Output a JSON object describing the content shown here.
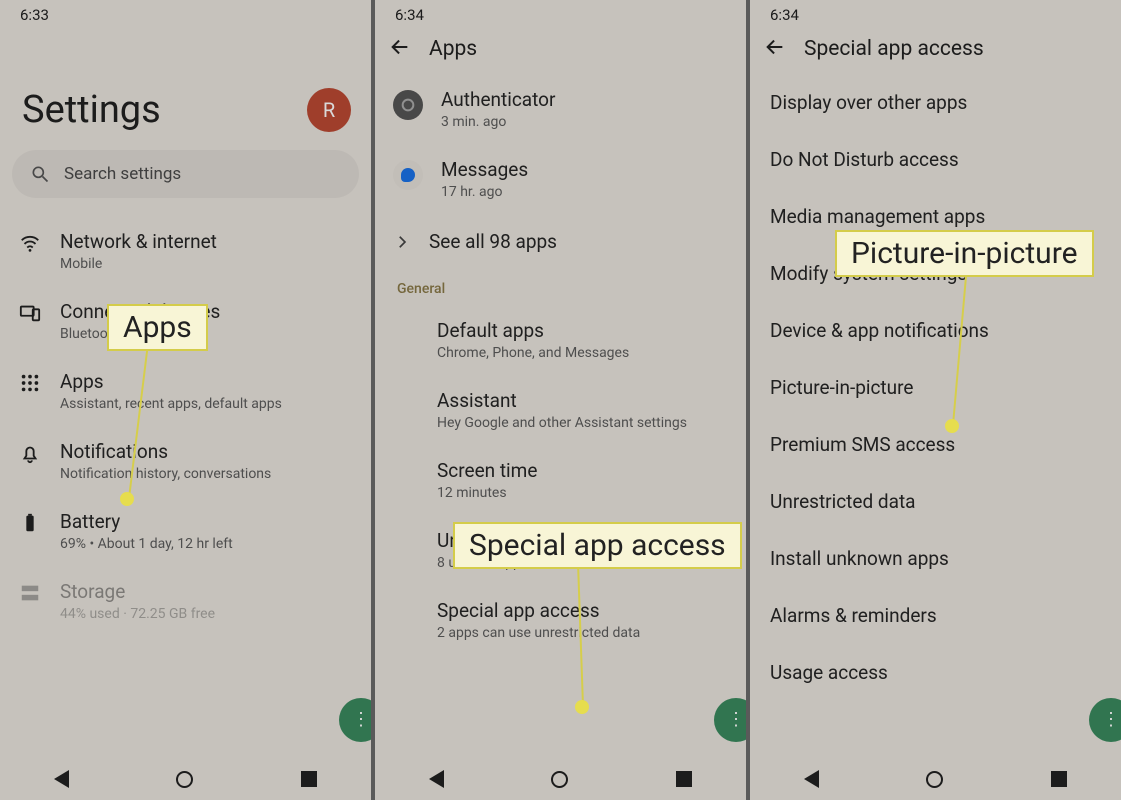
{
  "panel1": {
    "time": "6:33",
    "title": "Settings",
    "avatar": "R",
    "searchPlaceholder": "Search settings",
    "items": [
      {
        "title": "Network & internet",
        "sub": "Mobile"
      },
      {
        "title": "Connected devices",
        "sub": "Bluetooth, pairing"
      },
      {
        "title": "Apps",
        "sub": "Assistant, recent apps, default apps"
      },
      {
        "title": "Notifications",
        "sub": "Notification history, conversations"
      },
      {
        "title": "Battery",
        "sub": "69% • About 1 day, 12 hr left"
      },
      {
        "title": "Storage",
        "sub": "44% used · 72.25 GB free"
      }
    ],
    "callout": "Apps"
  },
  "panel2": {
    "time": "6:34",
    "header": "Apps",
    "recentApps": [
      {
        "title": "Authenticator",
        "sub": "3 min. ago"
      },
      {
        "title": "Messages",
        "sub": "17 hr. ago"
      }
    ],
    "seeAll": "See all 98 apps",
    "sectionLabel": "General",
    "generalItems": [
      {
        "title": "Default apps",
        "sub": "Chrome, Phone, and Messages"
      },
      {
        "title": "Assistant",
        "sub": "Hey Google and other Assistant settings"
      },
      {
        "title": "Screen time",
        "sub": "12 minutes"
      },
      {
        "title": "Unused apps",
        "sub": "8 unused apps"
      },
      {
        "title": "Special app access",
        "sub": "2 apps can use unrestricted data"
      }
    ],
    "callout": "Special app access"
  },
  "panel3": {
    "time": "6:34",
    "header": "Special app access",
    "items": [
      "Display over other apps",
      "Do Not Disturb access",
      "Media management apps",
      "Modify system settings",
      "Device & app notifications",
      "Picture-in-picture",
      "Premium SMS access",
      "Unrestricted data",
      "Install unknown apps",
      "Alarms & reminders",
      "Usage access"
    ],
    "callout": "Picture-in-picture"
  }
}
